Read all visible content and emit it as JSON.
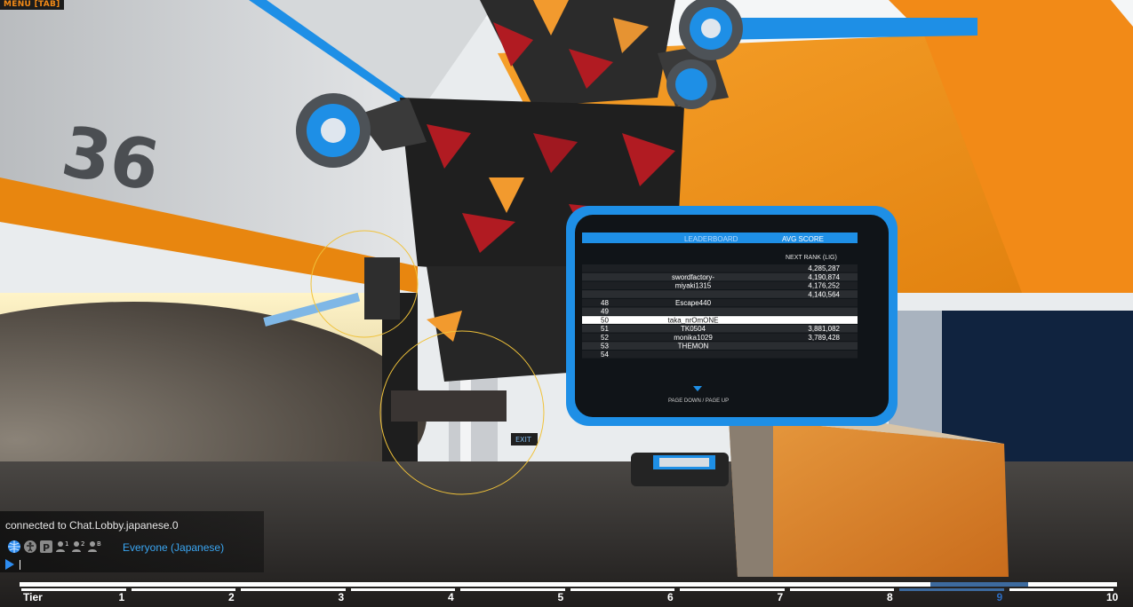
{
  "menu": {
    "label": "MENU [TAB]"
  },
  "backdrop": {
    "wall_number": "36",
    "exit_sign": "EXIT"
  },
  "scoreboard": {
    "header_left": "LEADERBOARD",
    "header_right": "AVG SCORE",
    "subheader": "NEXT RANK (LIG)",
    "rows": [
      {
        "rank": "",
        "name": "",
        "score": "4,285,287"
      },
      {
        "rank": "",
        "name": "swordfactory-",
        "score": "4,190,874"
      },
      {
        "rank": "",
        "name": "miyaki1315",
        "score": "4,176,252"
      },
      {
        "rank": "",
        "name": "",
        "score": "4,140,564"
      },
      {
        "rank": "48",
        "name": "Escape440",
        "score": ""
      },
      {
        "rank": "49",
        "name": "",
        "score": ""
      },
      {
        "rank": "50",
        "name": "taka_nrOmONE",
        "score": ""
      },
      {
        "rank": "51",
        "name": "TK0504",
        "score": "3,881,082"
      },
      {
        "rank": "52",
        "name": "monika1029",
        "score": "3,789,428"
      },
      {
        "rank": "53",
        "name": "THEMON",
        "score": ""
      },
      {
        "rank": "54",
        "name": "",
        "score": ""
      }
    ],
    "footer": "PAGE DOWN / PAGE UP"
  },
  "chat": {
    "status": "connected to Chat.Lobby.japanese.0",
    "channel": "Everyone (Japanese)",
    "input_value": ""
  },
  "tier_bar": {
    "label": "Tier",
    "tiers": [
      "1",
      "2",
      "3",
      "4",
      "5",
      "6",
      "7",
      "8",
      "9",
      "10"
    ],
    "current": "9"
  },
  "colors": {
    "accent_orange": "#f28a17",
    "ui_blue": "#2d6dc3",
    "chat_text": "#3aa6f2"
  }
}
